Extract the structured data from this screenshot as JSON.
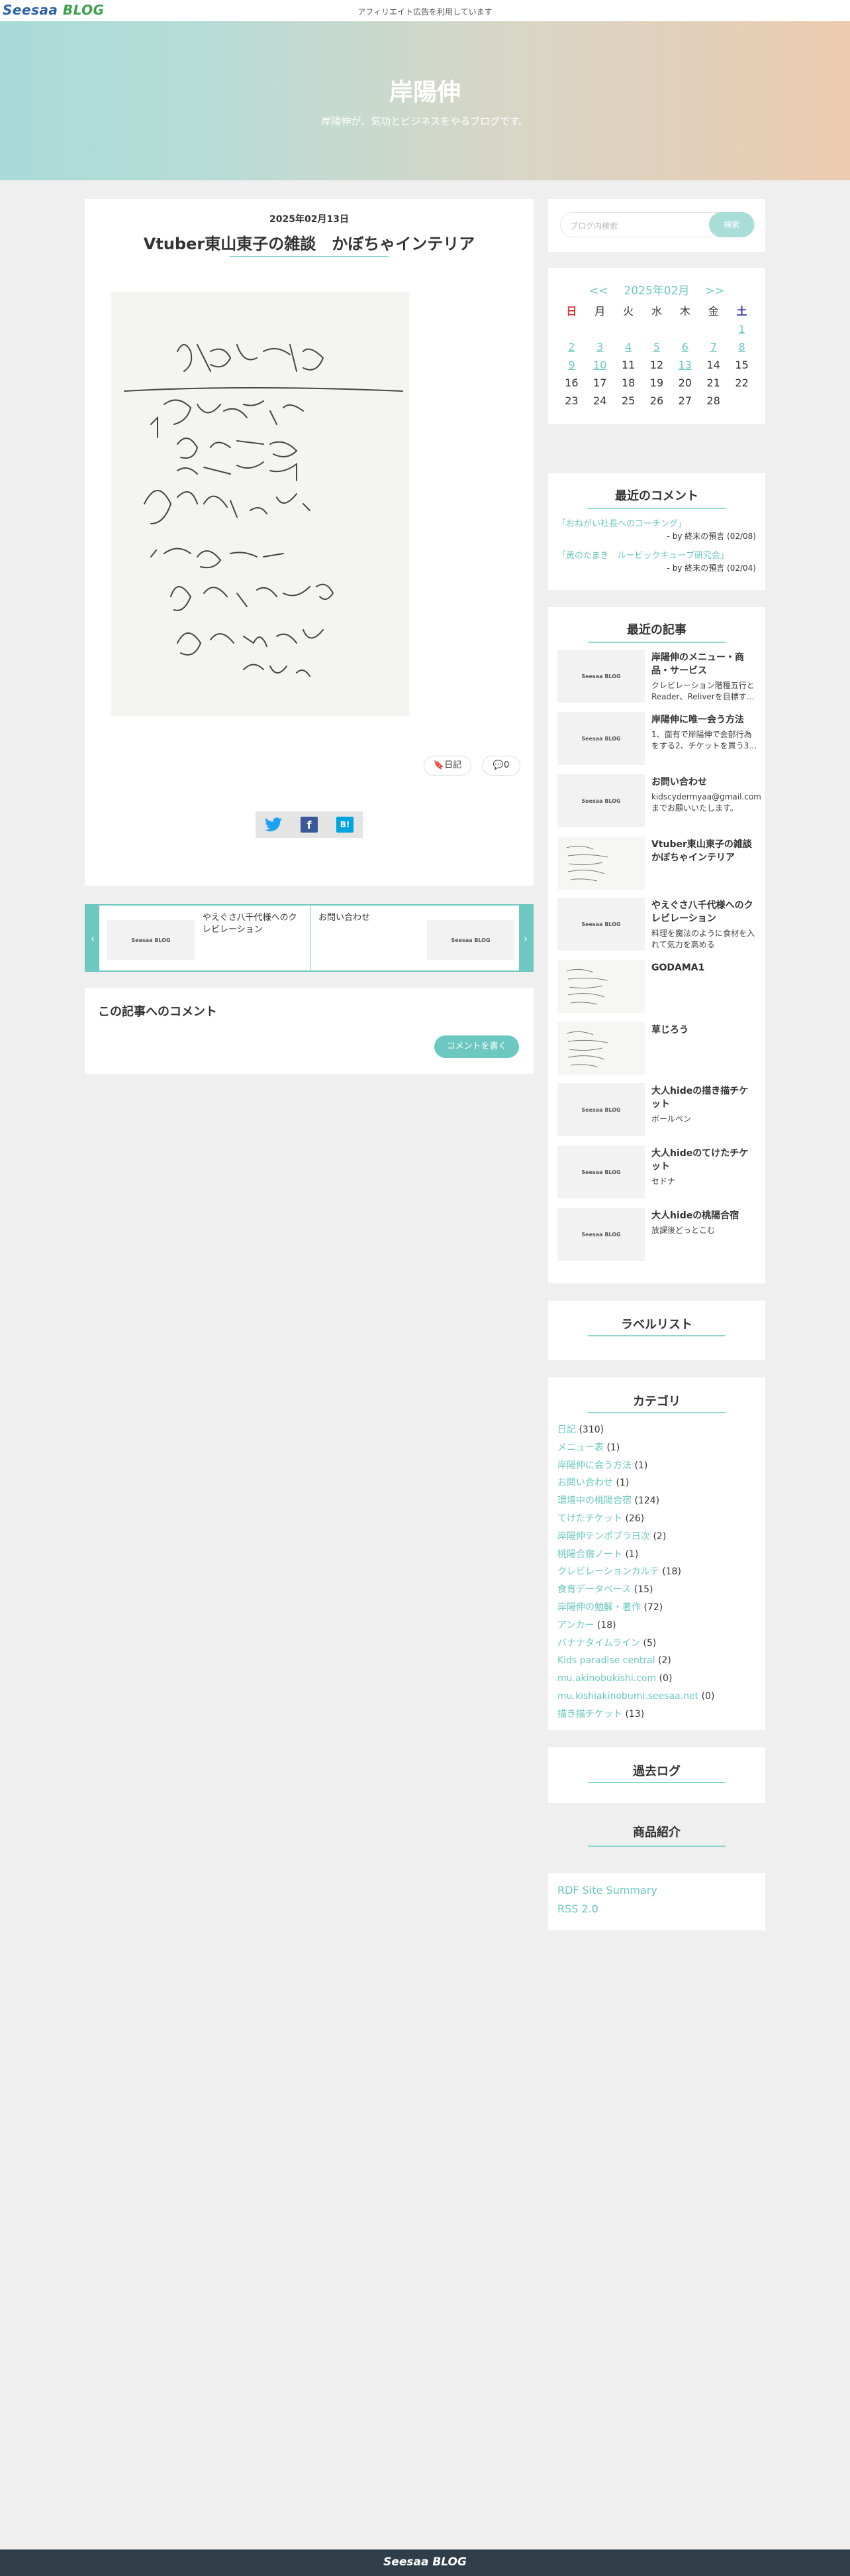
{
  "topbar": {
    "logo_a": "Seesaa",
    "logo_b": "BLOG",
    "notice": "アフィリエイト広告を利用しています"
  },
  "blog": {
    "title": "岸陽伸",
    "subtitle": "岸陽伸が、気功とビジネスをやるブログです。"
  },
  "article": {
    "date": "2025年02月13日",
    "title": "Vtuber東山東子の雑談　かぼちゃインテリア",
    "tag_label": "日記",
    "comment_count": "0",
    "share": {
      "twitter": "twitter-icon",
      "facebook": "f",
      "hatena": "B!"
    }
  },
  "prevnext": {
    "prev_thumb": "Seesaa BLOG",
    "prev_title": "やえぐさ八千代様へのクレビレーション",
    "next_thumb": "Seesaa BLOG",
    "next_title": "お問い合わせ"
  },
  "comments": {
    "heading": "この記事へのコメント",
    "write_label": "コメントを書く"
  },
  "search": {
    "placeholder": "ブログ内検索",
    "button": "検索"
  },
  "calendar": {
    "prev": "<<",
    "month": "2025年02月",
    "next": ">>",
    "weekdays": [
      "日",
      "月",
      "火",
      "水",
      "木",
      "金",
      "土"
    ],
    "days": [
      "",
      "",
      "",
      "",
      "",
      "",
      "1",
      "2",
      "3",
      "4",
      "5",
      "6",
      "7",
      "8",
      "9",
      "10",
      "11",
      "12",
      "13",
      "14",
      "15",
      "16",
      "17",
      "18",
      "19",
      "20",
      "21",
      "22",
      "23",
      "24",
      "25",
      "26",
      "27",
      "28",
      ""
    ],
    "linked_days": [
      "1",
      "2",
      "3",
      "4",
      "5",
      "6",
      "7",
      "8",
      "9",
      "10",
      "13"
    ]
  },
  "recent_comments": {
    "heading": "最近のコメント",
    "items": [
      {
        "link": "「おねがい社長へのコーチング」",
        "by": "- by 終末の預言 (02/08)"
      },
      {
        "link": "「黄のたまき　ルービックキューブ研究会」",
        "by": "- by 終末の預言 (02/04)"
      }
    ]
  },
  "recent_articles": {
    "heading": "最近の記事",
    "items": [
      {
        "thumb": "Seesaa BLOG",
        "title": "岸陽伸のメニュー・商品・サービス",
        "desc": "クレビレーション階種五行とReader、Reliverを目標す…"
      },
      {
        "thumb": "Seesaa BLOG",
        "title": "岸陽伸に唯一会う方法",
        "desc": "1、面有で岸陽伸で会部行為をする2、チケットを買う3…"
      },
      {
        "thumb": "Seesaa BLOG",
        "title": "お問い合わせ",
        "desc": "kidscydermyaa@gmail.comまでお願いいたします。"
      },
      {
        "thumb": "",
        "title": "Vtuber東山東子の雑談　かぼちゃインテリア",
        "desc": ""
      },
      {
        "thumb": "Seesaa BLOG",
        "title": "やえぐさ八千代様へのクレビレーション",
        "desc": "料理を魔法のように食材を入れて気力を高める"
      },
      {
        "thumb": "",
        "title": "GODAMA1",
        "desc": ""
      },
      {
        "thumb": "",
        "title": "草じろう",
        "desc": ""
      },
      {
        "thumb": "Seesaa BLOG",
        "title": "大人hideの描き描チケット",
        "desc": "ボールペン"
      },
      {
        "thumb": "Seesaa BLOG",
        "title": "大人hideのてけたチケット",
        "desc": "セドナ"
      },
      {
        "thumb": "Seesaa BLOG",
        "title": "大人hideの桃陽合宿",
        "desc": "放課後どっとこむ"
      }
    ]
  },
  "label_list": {
    "heading": "ラベルリスト"
  },
  "categories": {
    "heading": "カテゴリ",
    "items": [
      {
        "name": "日記",
        "count": "(310)"
      },
      {
        "name": "メニュー表",
        "count": "(1)"
      },
      {
        "name": "岸陽伸に会う方法",
        "count": "(1)"
      },
      {
        "name": "お問い合わせ",
        "count": "(1)"
      },
      {
        "name": "環境中の桃陽合宿",
        "count": "(124)"
      },
      {
        "name": "てけたチケット",
        "count": "(26)"
      },
      {
        "name": "岸陽伸テンポプラ日次",
        "count": "(2)"
      },
      {
        "name": "桃陽合宿ノート",
        "count": "(1)"
      },
      {
        "name": "クレビレーションカルテ",
        "count": "(18)"
      },
      {
        "name": "食育データベース",
        "count": "(15)"
      },
      {
        "name": "岸陽伸の勉解・著作",
        "count": "(72)"
      },
      {
        "name": "アンカー",
        "count": "(18)"
      },
      {
        "name": "バナナタイムライン",
        "count": "(5)"
      },
      {
        "name": "Kids paradise central",
        "count": "(2)"
      },
      {
        "name": "mu.akinobukishi.com",
        "count": "(0)"
      },
      {
        "name": "mu.kishiakinobumi.seesaa.net",
        "count": "(0)"
      },
      {
        "name": "描き描チケット",
        "count": "(13)"
      }
    ]
  },
  "archive": {
    "heading": "過去ログ"
  },
  "products": {
    "heading": "商品紹介"
  },
  "rss": {
    "rdf": "RDF Site Summary",
    "rss2": "RSS 2.0"
  },
  "footer": {
    "logo": "Seesaa BLOG"
  },
  "colors": {
    "accent": "#6cc8c0",
    "footer": "#2f3e48"
  }
}
